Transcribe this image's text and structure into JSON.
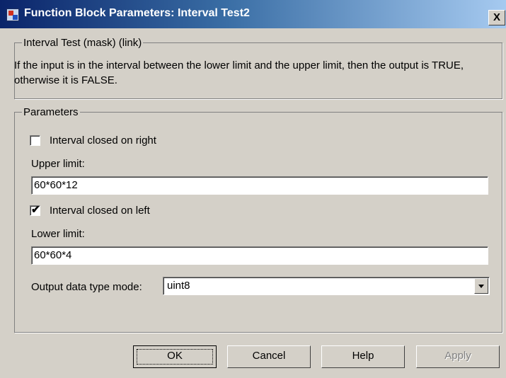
{
  "window": {
    "title": "Function Block Parameters: Interval Test2",
    "close_glyph": "X"
  },
  "mask_group": {
    "legend": "Interval Test (mask) (link)",
    "description": "If the input is in the interval between the lower limit and the upper limit, then the output is TRUE, otherwise it is FALSE."
  },
  "params_group": {
    "legend": "Parameters",
    "closed_right": {
      "label": "Interval closed on right",
      "checked": false
    },
    "upper_limit": {
      "label": "Upper limit:",
      "value": "60*60*12"
    },
    "closed_left": {
      "label": "Interval closed on left",
      "checked": true,
      "mark": "✔"
    },
    "lower_limit": {
      "label": "Lower limit:",
      "value": "60*60*4"
    },
    "output_mode": {
      "label": "Output data type mode:",
      "value": "uint8"
    }
  },
  "buttons": {
    "ok": "OK",
    "cancel": "Cancel",
    "help": "Help",
    "apply": "Apply"
  },
  "icons": {
    "app": "simulink-block-icon",
    "dropdown": "chevron-down-icon"
  }
}
